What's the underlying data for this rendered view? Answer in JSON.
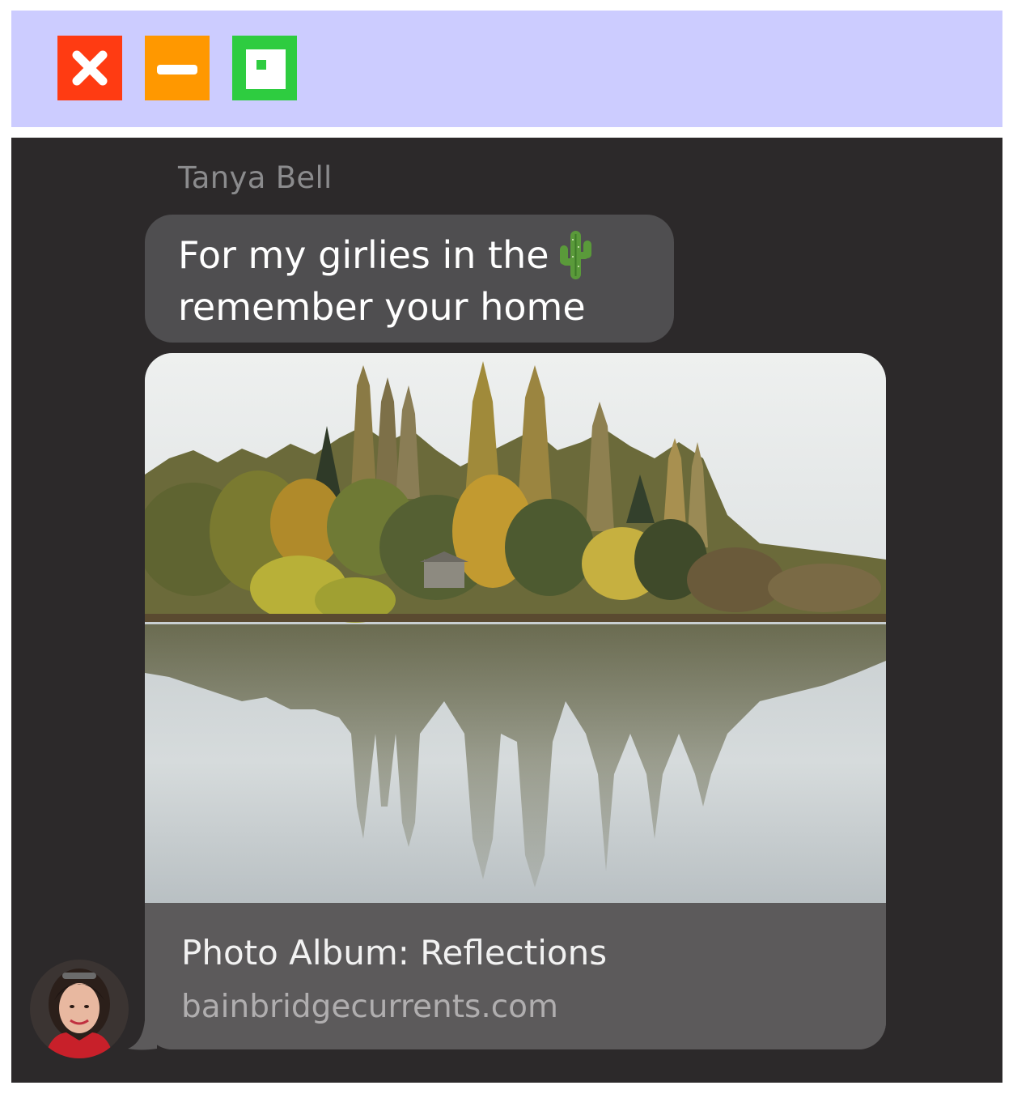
{
  "window": {
    "buttons": {
      "close": "close-icon",
      "minimize": "minimize-icon",
      "maximize": "maximize-icon"
    },
    "colors": {
      "titlebar": "#ccccff",
      "close": "#ff3b12",
      "minimize": "#ff9800",
      "maximize": "#2ecc40"
    }
  },
  "message": {
    "sender": "Tanya Bell",
    "text_line1": "For my girlies in the",
    "text_emoji": "cactus-emoji",
    "text_line2": "remember your home",
    "bubble_color": "#4f4e50"
  },
  "link_preview": {
    "title": "Photo Album: Reflections",
    "domain": "bainbridgecurrents.com",
    "image": "lake-reflection-autumn-trees-photo"
  },
  "avatar": {
    "icon": "sender-avatar"
  }
}
